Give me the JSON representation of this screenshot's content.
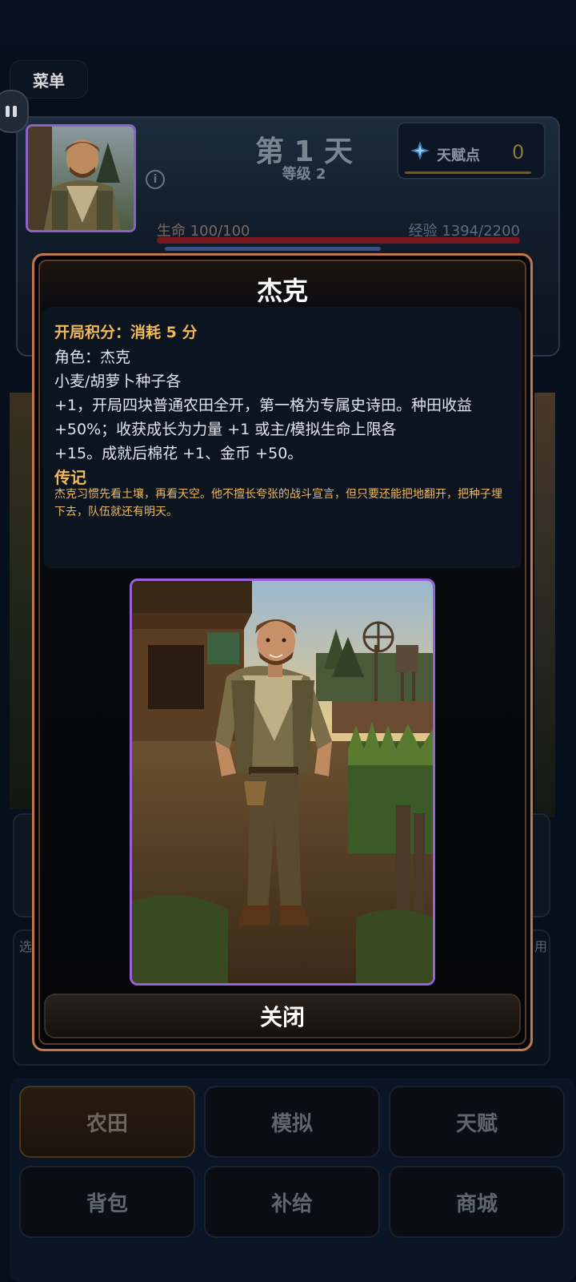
{
  "header": {
    "menu_label": "菜单",
    "day": "第 1 天",
    "level": "等级 2",
    "info_glyph": "i",
    "talent_label": "天赋点",
    "talent_value": "0",
    "hp_label": "生命 100/100",
    "exp_label": "经验 1394/2200",
    "hp_fraction": 1.0,
    "exp_fraction": 0.634
  },
  "background": {
    "left_partial": "选",
    "right_partial": "用"
  },
  "modal": {
    "title": "杰克",
    "cost": "开局积分：消耗 5 分",
    "lines": [
      "角色：杰克",
      "小麦/胡萝卜种子各",
      "+1，开局四块普通农田全开，第一格为专属史诗田。种田收益",
      "+50%；收获成长为力量 +1 或主/模拟生命上限各",
      "+15。成就后棉花 +1、金币 +50。"
    ],
    "lore_title": "传记",
    "lore_text": "杰克习惯先看土壤，再看天空。他不擅长夸张的战斗宣言，但只要还能把地翻开，把种子埋下去，队伍就还有明天。",
    "close_label": "关闭"
  },
  "nav": {
    "items": [
      "农田",
      "模拟",
      "天赋",
      "背包",
      "补给",
      "商城"
    ],
    "active": "农田"
  },
  "colors": {
    "accent_gold": "#f0b85a",
    "portrait_border": "#9a60d8",
    "modal_border": "#c0784a",
    "hp_bar": "#7a1820",
    "exp_bar": "#3c5080"
  }
}
